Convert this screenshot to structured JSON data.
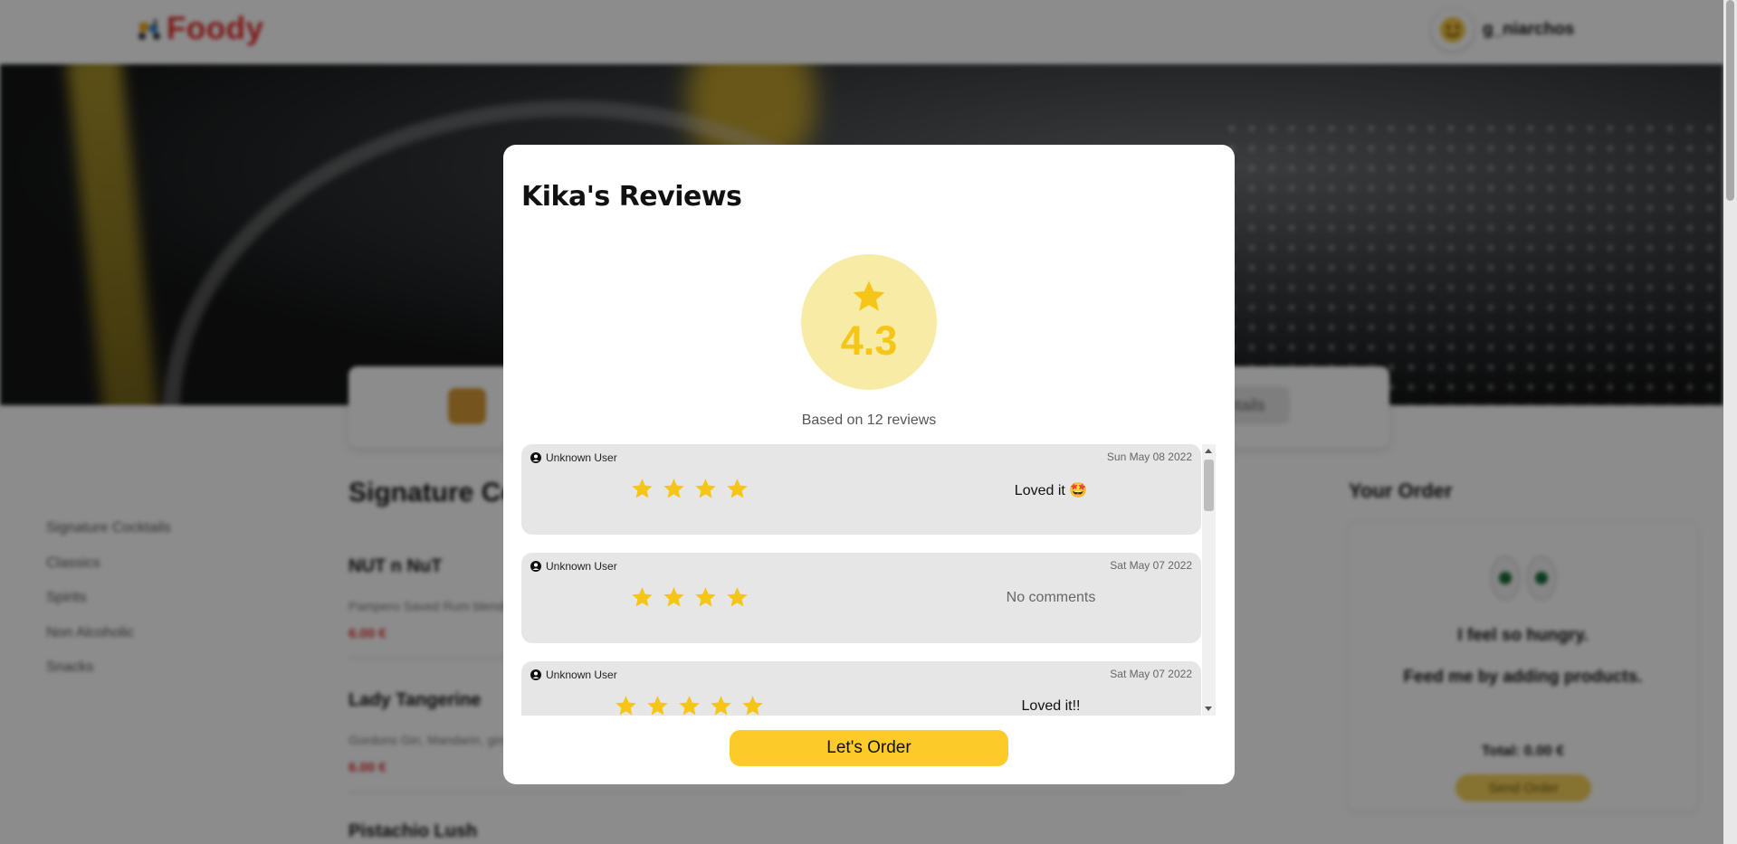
{
  "header": {
    "brand": "Foody",
    "username": "g_niarchos"
  },
  "restaurant": {
    "details_button": "Details"
  },
  "categories": [
    "Signature Cocktails",
    "Classics",
    "Spirits",
    "Non Alcoholic",
    "Snacks"
  ],
  "menu": {
    "section_title": "Signature Cocktails",
    "products": [
      {
        "name": "NUT n NuT",
        "description": "Pampero Saved Rum blended",
        "price": "6.00 €"
      },
      {
        "name": "Lady Tangerine",
        "description": "Gordons Gin, Mandarin, ginger",
        "price": "6.00 €"
      },
      {
        "name": "Pistachio Lush",
        "description": "",
        "price": ""
      }
    ]
  },
  "order": {
    "title": "Your Order",
    "empty_line1": "I feel so hungry.",
    "empty_line2": "Feed me by adding products.",
    "total": "Total: 0.00 €",
    "send_button": "Send Order"
  },
  "modal": {
    "title": "Kika's Reviews",
    "average_rating": "4.3",
    "based_on": "Based on 12 reviews",
    "order_button": "Let's Order",
    "reviews": [
      {
        "user": "Unknown User",
        "date": "Sun May 08 2022",
        "stars": 4,
        "comment": "Loved it 🤩",
        "muted": false
      },
      {
        "user": "Unknown User",
        "date": "Sat May 07 2022",
        "stars": 4,
        "comment": "No comments",
        "muted": true
      },
      {
        "user": "Unknown User",
        "date": "Sat May 07 2022",
        "stars": 5,
        "comment": "Loved it!!",
        "muted": false
      }
    ]
  },
  "colors": {
    "brand_red": "#e52b2b",
    "star_yellow": "#f5c518",
    "rating_circle": "#f7eba6",
    "order_button": "#fccb2a",
    "review_bg": "#e6e6e6"
  }
}
